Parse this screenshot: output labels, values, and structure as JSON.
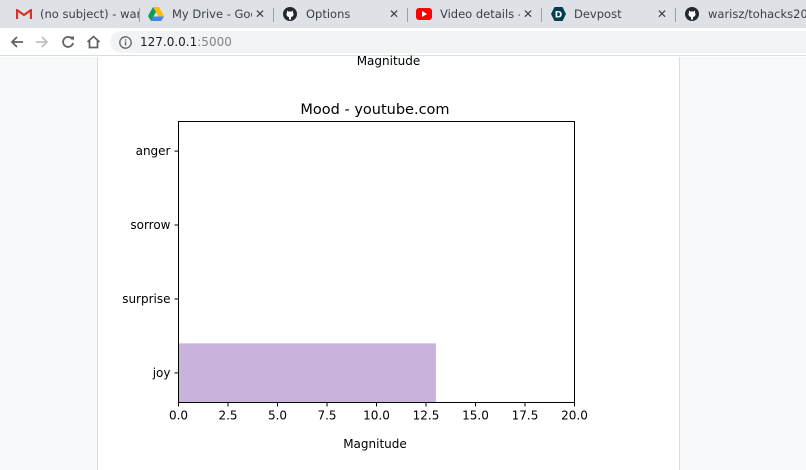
{
  "browser": {
    "tabs": [
      {
        "title": "(no subject) - waris",
        "icon": "gmail-icon"
      },
      {
        "title": "My Drive - Google Drive",
        "icon": "google-drive-icon"
      },
      {
        "title": "Options",
        "icon": "github-icon"
      },
      {
        "title": "Video details - YouTube",
        "icon": "youtube-icon"
      },
      {
        "title": "Devpost",
        "icon": "devpost-icon"
      },
      {
        "title": "warisz/tohacks20",
        "icon": "github-icon"
      }
    ],
    "url_host": "127.0.0.1",
    "url_port": ":5000"
  },
  "page": {
    "previous_chart_xlabel": "Magnitude"
  },
  "chart_data": {
    "type": "bar",
    "orientation": "horizontal",
    "title": "Mood - youtube.com",
    "xlabel": "Magnitude",
    "ylabel": "",
    "categories": [
      "anger",
      "sorrow",
      "surprise",
      "joy"
    ],
    "values": [
      0,
      0,
      0,
      13
    ],
    "xlim": [
      0,
      20
    ],
    "xticks": [
      "0.0",
      "2.5",
      "5.0",
      "7.5",
      "10.0",
      "12.5",
      "15.0",
      "17.5",
      "20.0"
    ],
    "bar_color": "#c9b3dc",
    "grid": false,
    "legend": "none"
  }
}
